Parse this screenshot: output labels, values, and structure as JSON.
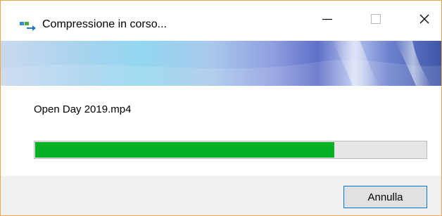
{
  "window": {
    "title": "Compressione in corso...",
    "accent_border": "#f0a64a"
  },
  "titlebar": {
    "icons": [
      "app-icon",
      "minimize-icon",
      "maximize-icon",
      "close-icon"
    ]
  },
  "content": {
    "filename": "Open Day 2019.mp4",
    "progress_fraction": 0.765,
    "progress_color": "#06b025"
  },
  "footer": {
    "cancel_label": "Annulla"
  }
}
